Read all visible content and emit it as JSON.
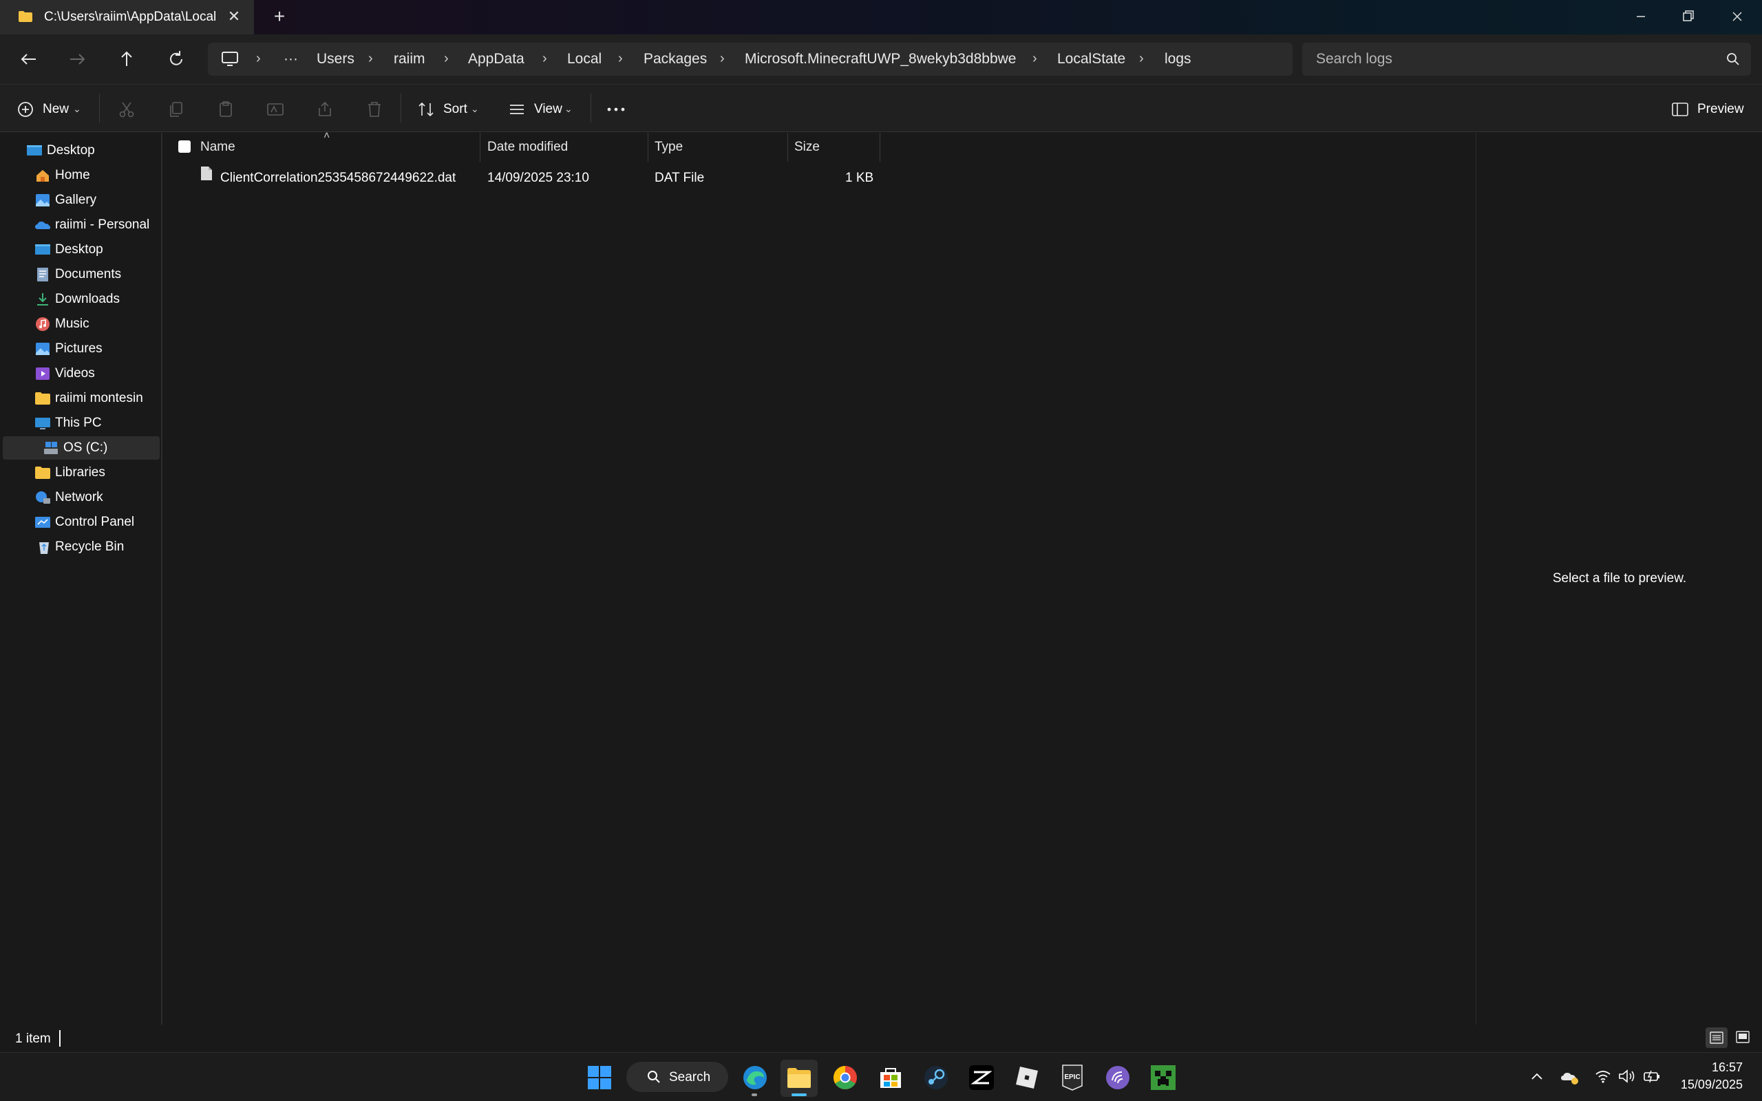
{
  "window": {
    "tab_title": "C:\\Users\\raiim\\AppData\\Local"
  },
  "breadcrumb": {
    "overflow": "···",
    "items": [
      "Users",
      "raiim",
      "AppData",
      "Local",
      "Packages",
      "Microsoft.MinecraftUWP_8wekyb3d8bbwe",
      "LocalState",
      "logs"
    ]
  },
  "search": {
    "placeholder": "Search logs"
  },
  "toolbar": {
    "new_label": "New",
    "sort_label": "Sort",
    "view_label": "View",
    "preview_label": "Preview"
  },
  "sidebar": {
    "items": [
      {
        "label": "Desktop",
        "icon": "desktop-icon"
      },
      {
        "label": "Home",
        "icon": "home-icon"
      },
      {
        "label": "Gallery",
        "icon": "gallery-icon"
      },
      {
        "label": "raiimi - Personal",
        "icon": "onedrive-icon"
      },
      {
        "label": "Desktop",
        "icon": "desktop-icon"
      },
      {
        "label": "Documents",
        "icon": "documents-icon"
      },
      {
        "label": "Downloads",
        "icon": "downloads-icon"
      },
      {
        "label": "Music",
        "icon": "music-icon"
      },
      {
        "label": "Pictures",
        "icon": "pictures-icon"
      },
      {
        "label": "Videos",
        "icon": "videos-icon"
      },
      {
        "label": "raiimi montesin",
        "icon": "folder-icon"
      },
      {
        "label": "This PC",
        "icon": "this-pc-icon"
      },
      {
        "label": "OS (C:)",
        "icon": "drive-icon",
        "selected": true
      },
      {
        "label": "Libraries",
        "icon": "libraries-icon"
      },
      {
        "label": "Network",
        "icon": "network-icon"
      },
      {
        "label": "Control Panel",
        "icon": "control-panel-icon"
      },
      {
        "label": "Recycle Bin",
        "icon": "recycle-bin-icon"
      }
    ]
  },
  "file_list": {
    "columns": [
      "Name",
      "Date modified",
      "Type",
      "Size"
    ],
    "rows": [
      {
        "name": "ClientCorrelation2535458672449622.dat",
        "date_modified": "14/09/2025 23:10",
        "type": "DAT File",
        "size": "1 KB"
      }
    ]
  },
  "preview_pane": {
    "message": "Select a file to preview."
  },
  "status_bar": {
    "item_count": "1 item"
  },
  "taskbar": {
    "search_label": "Search",
    "apps": [
      "start-icon",
      "edge-icon",
      "file-explorer-icon",
      "chrome-icon",
      "store-icon",
      "steam-icon",
      "capcut-icon",
      "roblox-icon",
      "epic-games-icon",
      "bittorrent-icon",
      "minecraft-icon"
    ],
    "time": "16:57",
    "date": "15/09/2025"
  },
  "colors": {
    "folder_yellow": "#f5c242",
    "accent_blue": "#4cc2ff",
    "background": "#191919"
  }
}
